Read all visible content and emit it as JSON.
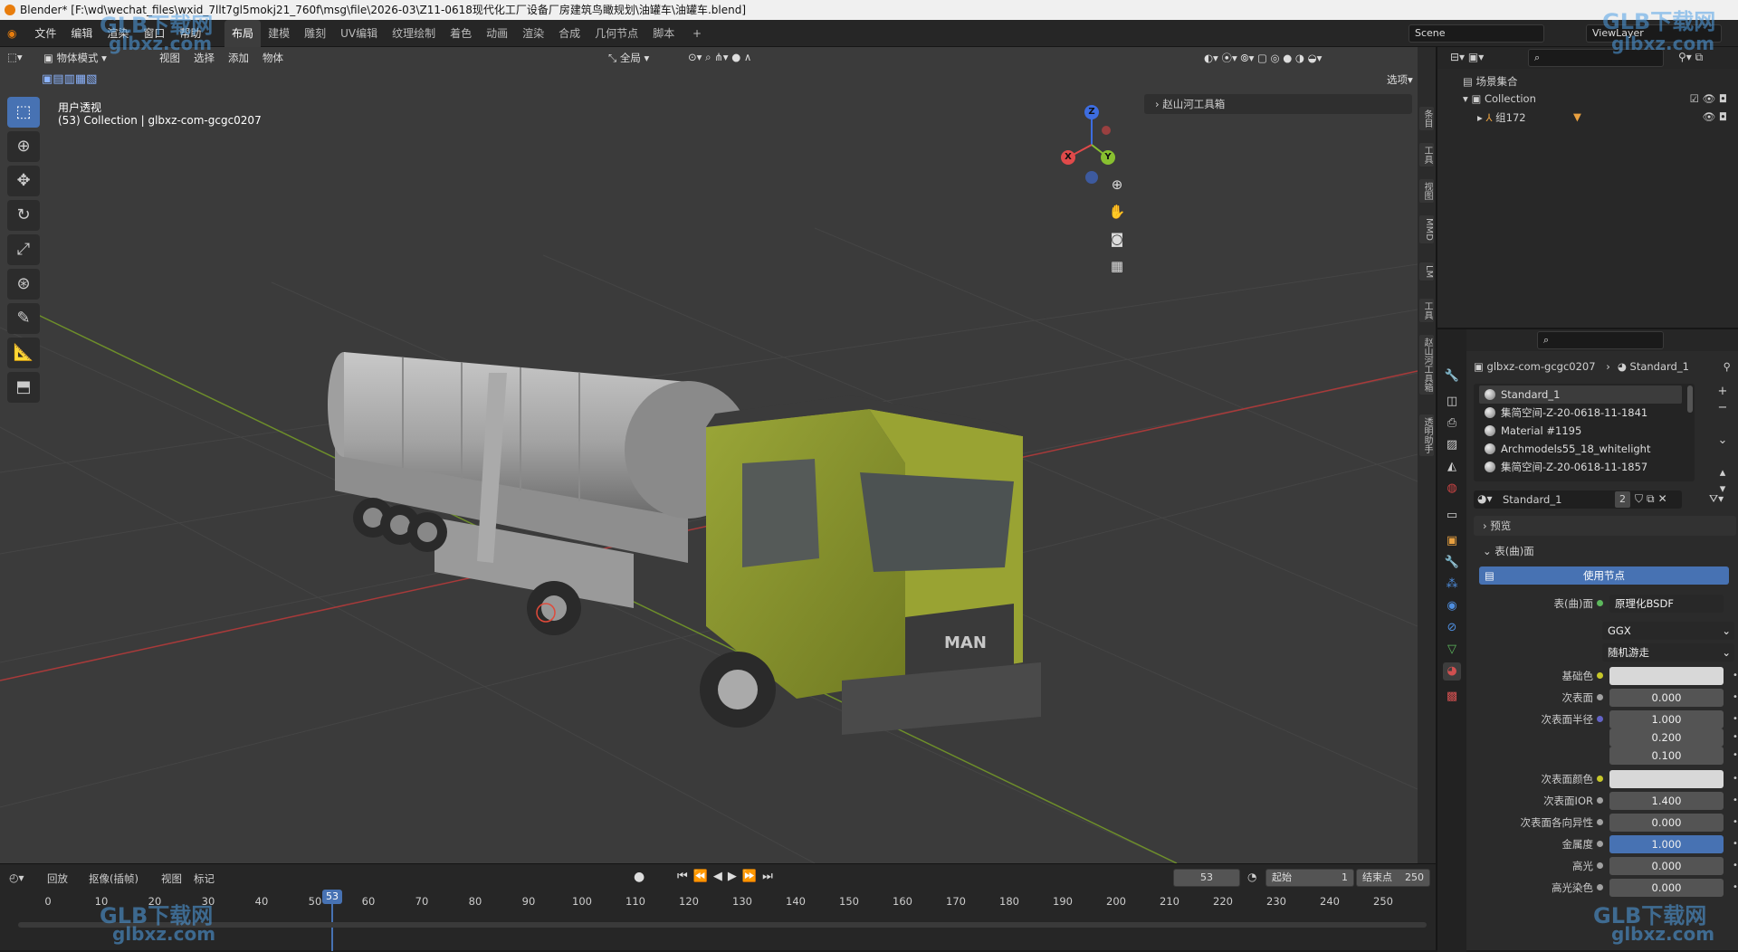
{
  "title_bar": {
    "text": "Blender* [F:\\wd\\wechat_files\\wxid_7llt7gl5mokj21_760f\\msg\\file\\2026-03\\Z11-0618现代化工厂设备厂房建筑鸟瞰规划\\油罐车\\油罐车.blend]"
  },
  "top_menu": [
    "文件",
    "编辑",
    "渲染",
    "窗口",
    "帮助"
  ],
  "workspaces": [
    {
      "label": "布局",
      "active": true
    },
    {
      "label": "建模"
    },
    {
      "label": "雕刻"
    },
    {
      "label": "UV编辑"
    },
    {
      "label": "纹理绘制"
    },
    {
      "label": "着色"
    },
    {
      "label": "动画"
    },
    {
      "label": "渲染"
    },
    {
      "label": "合成"
    },
    {
      "label": "几何节点"
    },
    {
      "label": "脚本"
    }
  ],
  "scene": {
    "label": "Scene",
    "viewlayer": "ViewLayer"
  },
  "viewport_header": {
    "mode": "物体模式",
    "menus": [
      "视图",
      "选择",
      "添加",
      "物体"
    ],
    "transform": "全局",
    "options": "选项"
  },
  "viewport": {
    "view_name": "用户透视",
    "collection_info": "(53) Collection | glbxz-com-gcgc0207",
    "n_panel": "赵山河工具箱",
    "truck_logo": "MAN"
  },
  "n_tabs": [
    "条目",
    "工具",
    "视图",
    "MMD",
    "LM",
    "工具",
    "赵山河工具箱",
    "透明助手"
  ],
  "gizmo": {
    "z": "Z",
    "x": "X",
    "y": "Y"
  },
  "outliner": {
    "scene_collection": "场景集合",
    "items": [
      {
        "label": "Collection"
      },
      {
        "label": "组172"
      }
    ]
  },
  "properties": {
    "breadcrumb_object": "glbxz-com-gcgc0207",
    "breadcrumb_material": "Standard_1",
    "materials": [
      "Standard_1",
      "集简空间-Z-20-0618-11-1841",
      "Material #1195",
      "Archmodels55_18_whitelight",
      "集简空间-Z-20-0618-11-1857"
    ],
    "material_name": "Standard_1",
    "user_count": "2",
    "preview": "预览",
    "surface_panel": "表(曲)面",
    "use_nodes": "使用节点",
    "surface_label": "表(曲)面",
    "surface_value": "原理化BSDF",
    "distribution": "GGX",
    "subsurface_method": "随机游走",
    "rows": [
      {
        "label": "基础色",
        "value": "",
        "type": "color",
        "dot": "#c7c729"
      },
      {
        "label": "次表面",
        "value": "0.000",
        "dot": "#a1a1a1"
      },
      {
        "label": "次表面半径",
        "value": "1.000",
        "dot": "#6363c7"
      },
      {
        "label": "",
        "value": "0.200"
      },
      {
        "label": "",
        "value": "0.100"
      },
      {
        "label": "次表面颜色",
        "value": "",
        "type": "color",
        "dot": "#c7c729"
      },
      {
        "label": "次表面IOR",
        "value": "1.400",
        "dot": "#a1a1a1"
      },
      {
        "label": "次表面各向异性",
        "value": "0.000",
        "dot": "#a1a1a1"
      },
      {
        "label": "金属度",
        "value": "1.000",
        "dot": "#a1a1a1",
        "highlight": true
      },
      {
        "label": "高光",
        "value": "0.000",
        "dot": "#a1a1a1"
      },
      {
        "label": "高光染色",
        "value": "0.000",
        "dot": "#a1a1a1"
      }
    ]
  },
  "timeline": {
    "menus": [
      "回放",
      "抠像(插帧)",
      "视图",
      "标记"
    ],
    "current_frame": "53",
    "start_label": "起始",
    "start": "1",
    "end_label": "结束点",
    "end": "250",
    "ticks": [
      "0",
      "10",
      "20",
      "30",
      "40",
      "50",
      "60",
      "70",
      "80",
      "90",
      "100",
      "110",
      "120",
      "130",
      "140",
      "150",
      "160",
      "170",
      "180",
      "190",
      "200",
      "210",
      "220",
      "230",
      "240",
      "250"
    ]
  },
  "watermark": {
    "brand": "GLB下载网",
    "url": "glbxz.com"
  }
}
